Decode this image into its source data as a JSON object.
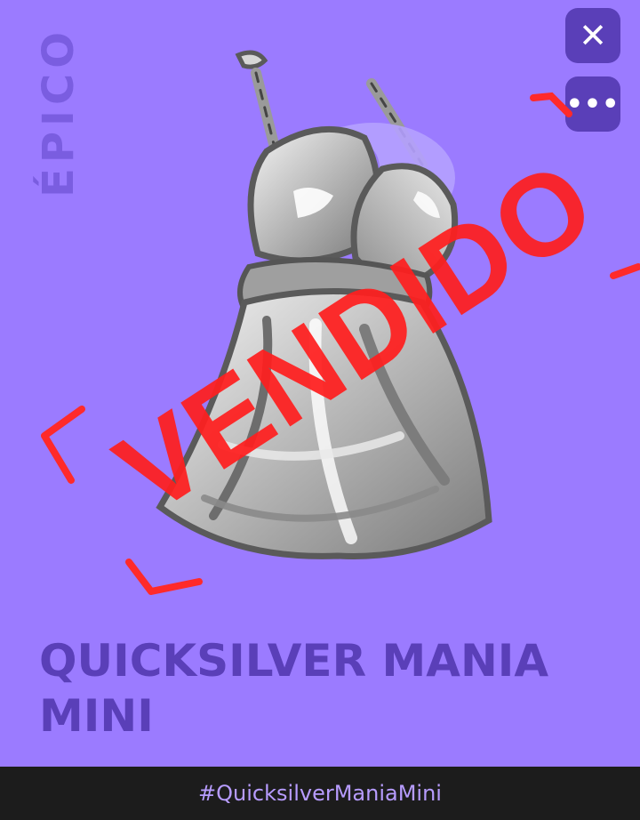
{
  "card": {
    "rarity": "ÉPICO",
    "title": "QUICKSILVER MANIA MINI",
    "sold_stamp": "VENDIDO",
    "hashtag": "#QuicksilverManiaMini"
  },
  "actions": {
    "close_glyph": "✕",
    "more_glyph": "•••"
  },
  "colors": {
    "card_bg": "#9b7bff",
    "title": "#5a3fb8",
    "stamp": "#ff1f1f",
    "footer_bg": "#1c1c1c"
  },
  "icons": [
    "close-icon",
    "more-options-icon",
    "dress-illustration"
  ]
}
